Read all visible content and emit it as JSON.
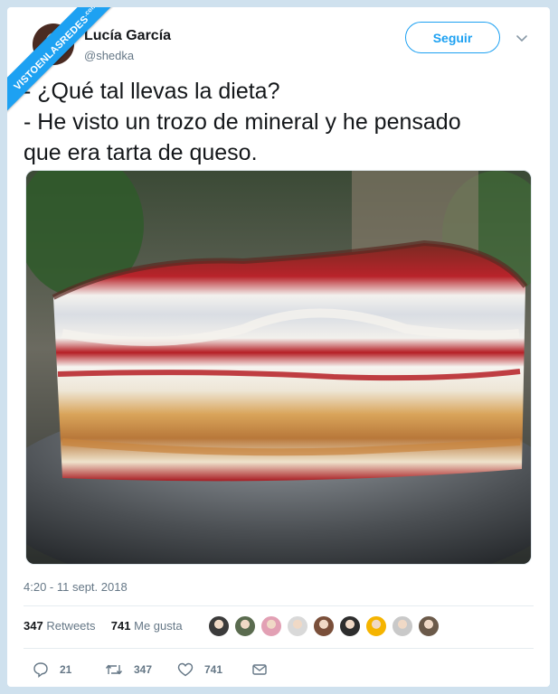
{
  "watermark": {
    "text": "VISTOENLASREDES",
    "suffix": ".com"
  },
  "tweet": {
    "author_name": "Lucía García",
    "author_handle": "@shedka",
    "follow_label": "Seguir",
    "lines": [
      "- ¿Qué tal llevas la dieta?",
      "- He visto un trozo de mineral y he pensado",
      "que era tarta de queso."
    ],
    "timestamp": "4:20 - 11 sept. 2018",
    "stats": {
      "retweets_count": "347",
      "retweets_label": "Retweets",
      "likes_count": "741",
      "likes_label": "Me gusta"
    },
    "actions": {
      "replies": "21",
      "retweets": "347",
      "likes": "741"
    }
  },
  "liker_colors": [
    "#3b3b3b",
    "#5a6b4f",
    "#e2a0b4",
    "#d9d9d9",
    "#7a4f3a",
    "#2d2d2d",
    "#f5b400",
    "#c9c9c9",
    "#6b5a4a"
  ],
  "colors": {
    "accent": "#1da1f2",
    "muted": "#657786",
    "text": "#14171a"
  }
}
